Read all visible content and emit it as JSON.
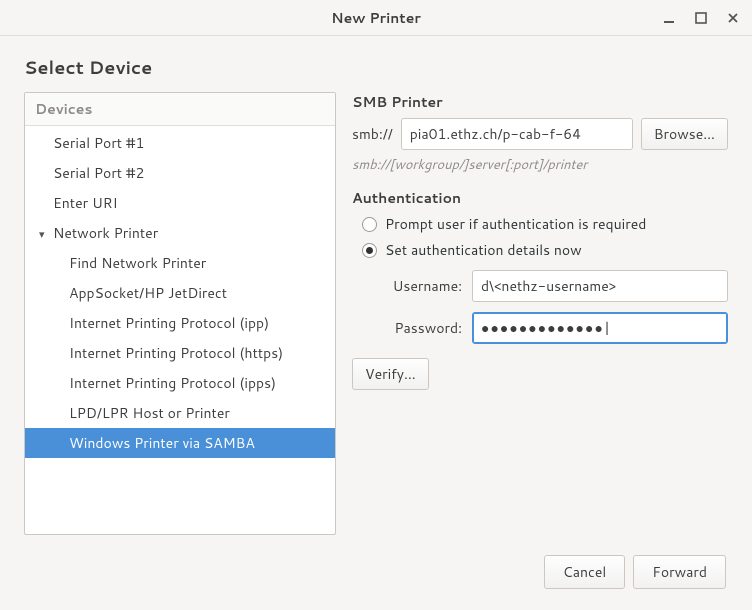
{
  "window": {
    "title": "New Printer"
  },
  "section_title": "Select Device",
  "devices": {
    "header": "Devices",
    "items": [
      {
        "label": "Serial Port #1",
        "depth": "root"
      },
      {
        "label": "Serial Port #2",
        "depth": "root"
      },
      {
        "label": "Enter URI",
        "depth": "root"
      },
      {
        "label": "Network Printer",
        "depth": "parent",
        "expanded": true
      },
      {
        "label": "Find Network Printer",
        "depth": "child"
      },
      {
        "label": "AppSocket/HP JetDirect",
        "depth": "child"
      },
      {
        "label": "Internet Printing Protocol (ipp)",
        "depth": "child"
      },
      {
        "label": "Internet Printing Protocol (https)",
        "depth": "child"
      },
      {
        "label": "Internet Printing Protocol (ipps)",
        "depth": "child"
      },
      {
        "label": "LPD/LPR Host or Printer",
        "depth": "child"
      },
      {
        "label": "Windows Printer via SAMBA",
        "depth": "child",
        "selected": true
      }
    ]
  },
  "smb": {
    "heading": "SMB Printer",
    "prefix": "smb://",
    "url_value": "pia01.ethz.ch/p-cab-f-64",
    "browse_label": "Browse…",
    "hint": "smb://[workgroup/]server[:port]/printer"
  },
  "auth": {
    "heading": "Authentication",
    "radio_prompt": "Prompt user if authentication is required",
    "radio_setnow": "Set authentication details now",
    "selected": "setnow",
    "username_label": "Username:",
    "username_value": "d\\<nethz-username>",
    "password_label": "Password:",
    "password_value": "●●●●●●●●●●●●●",
    "verify_label": "Verify…"
  },
  "footer": {
    "cancel": "Cancel",
    "forward": "Forward"
  }
}
